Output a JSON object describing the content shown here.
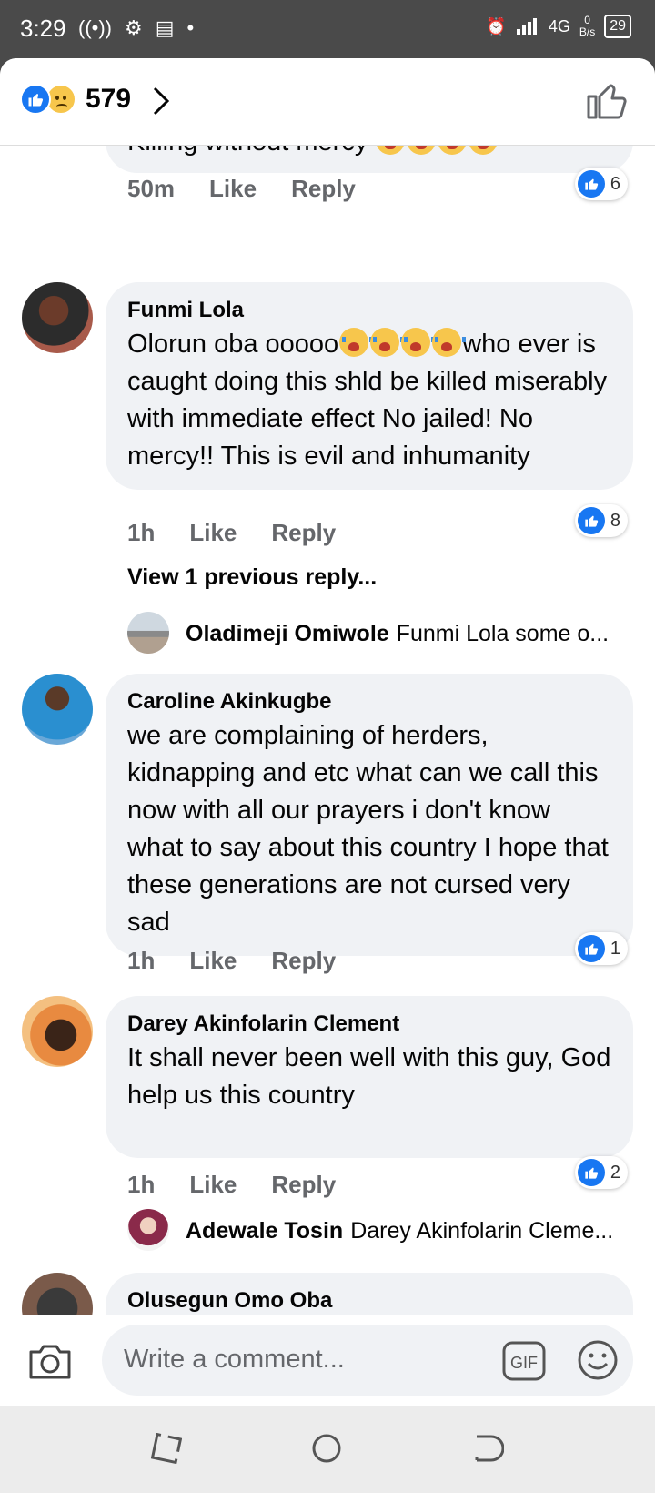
{
  "status_bar": {
    "time": "3:29",
    "network": "4G",
    "net_speed_value": "0",
    "net_speed_unit": "B/s",
    "battery": "29"
  },
  "header": {
    "reaction_count": "579"
  },
  "comments": [
    {
      "text": "Killing without mercy",
      "time": "50m",
      "like_label": "Like",
      "reply_label": "Reply",
      "likes": "6"
    },
    {
      "name": "Funmi Lola",
      "text_before_emoji": "Olorun oba ooooo",
      "text_after_emoji": "who ever is caught doing this shld be killed miserably with immediate effect No jailed! No mercy!! This is evil and inhumanity",
      "time": "1h",
      "like_label": "Like",
      "reply_label": "Reply",
      "likes": "8",
      "view_previous": "View 1 previous reply...",
      "reply_preview": {
        "name": "Oladimeji Omiwole",
        "text": "Funmi Lola some o..."
      }
    },
    {
      "name": "Caroline Akinkugbe",
      "text": "we are complaining of herders, kidnapping and etc what can we call this now with all our prayers i don't know what to say about this country I hope that these generations are not cursed very sad",
      "time": "1h",
      "like_label": "Like",
      "reply_label": "Reply",
      "likes": "1"
    },
    {
      "name": "Darey Akinfolarin Clement",
      "text": "It shall never been well with this guy, God help us this country",
      "time": "1h",
      "like_label": "Like",
      "reply_label": "Reply",
      "likes": "2",
      "reply_preview": {
        "name": "Adewale Tosin",
        "text": "Darey Akinfolarin Cleme..."
      }
    },
    {
      "name": "Olusegun Omo Oba"
    }
  ],
  "composer": {
    "placeholder": "Write a comment...",
    "gif_label": "GIF"
  },
  "colors": {
    "facebook_blue": "#1877f2",
    "bubble_gray": "#f0f2f5",
    "secondary_text": "#65676b"
  }
}
